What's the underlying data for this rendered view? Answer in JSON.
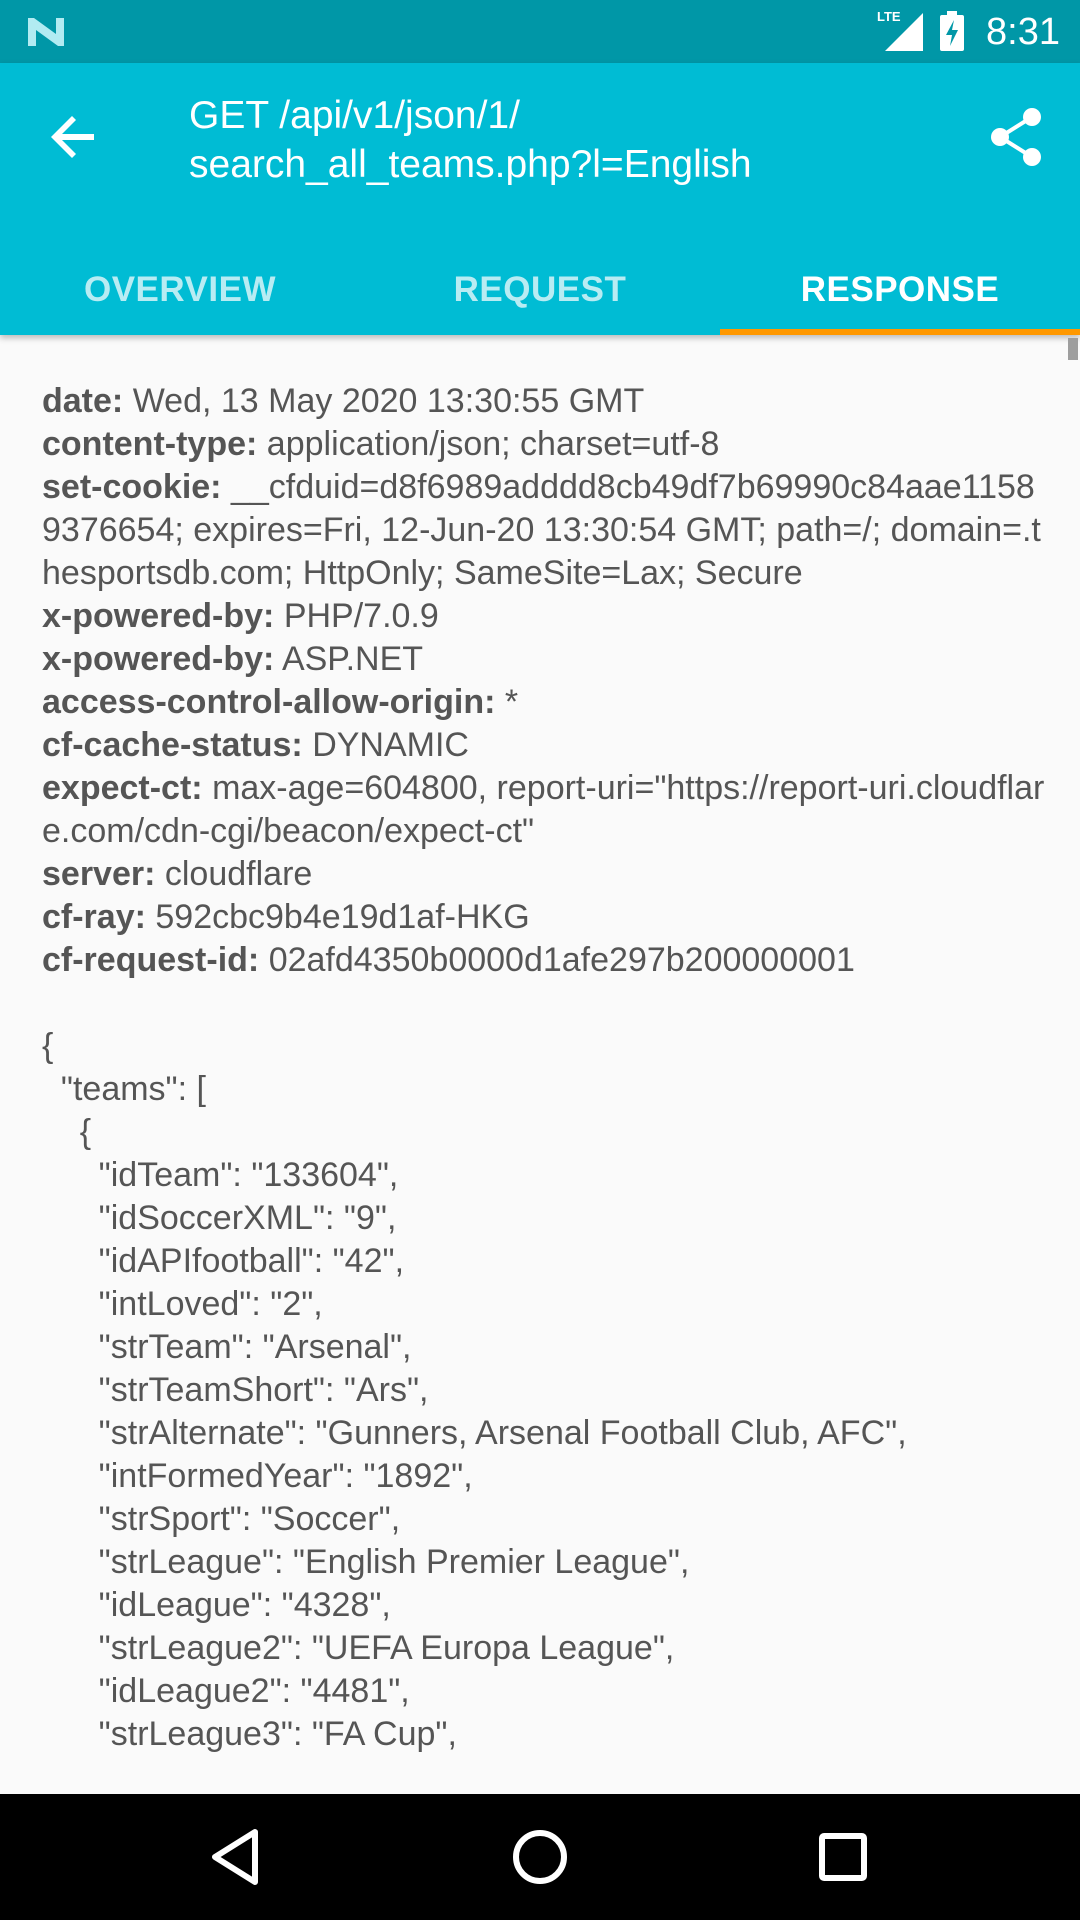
{
  "status_bar": {
    "time": "8:31",
    "network_label": "LTE",
    "icons": [
      "n-logo-icon",
      "lte-signal-icon",
      "battery-charging-icon"
    ]
  },
  "app_bar": {
    "title": "GET /api/v1/json/1/\nsearch_all_teams.php?l=English",
    "back_icon": "arrow-back-icon",
    "share_icon": "share-icon"
  },
  "tabs": [
    {
      "label": "OVERVIEW",
      "active": false
    },
    {
      "label": "REQUEST",
      "active": false
    },
    {
      "label": "RESPONSE",
      "active": true
    }
  ],
  "colors": {
    "status_bar": "#0097a7",
    "app_bar": "#00bcd4",
    "tab_indicator": "#ff9800",
    "background": "#fafafa",
    "text": "#555555"
  },
  "response": {
    "headers": [
      {
        "key": "date:",
        "value": "Wed, 13 May 2020 13:30:55 GMT"
      },
      {
        "key": "content-type:",
        "value": "application/json; charset=utf-8"
      },
      {
        "key": "set-cookie:",
        "value": "__cfduid=d8f6989adddd8cb49df7b69990c84aae11589376654; expires=Fri, 12-Jun-20 13:30:54 GMT; path=/; domain=.thesportsdb.com; HttpOnly; SameSite=Lax; Secure"
      },
      {
        "key": "x-powered-by:",
        "value": "PHP/7.0.9"
      },
      {
        "key": "x-powered-by:",
        "value": "ASP.NET"
      },
      {
        "key": "access-control-allow-origin:",
        "value": "*"
      },
      {
        "key": "cf-cache-status:",
        "value": "DYNAMIC"
      },
      {
        "key": "expect-ct:",
        "value": "max-age=604800, report-uri=\"https://report-uri.cloudflare.com/cdn-cgi/beacon/expect-ct\""
      },
      {
        "key": "server:",
        "value": "cloudflare"
      },
      {
        "key": "cf-ray:",
        "value": "592cbc9b4e19d1af-HKG"
      },
      {
        "key": "cf-request-id:",
        "value": "02afd4350b0000d1afe297b200000001"
      }
    ],
    "body_lines": [
      "{",
      "  \"teams\": [",
      "    {",
      "      \"idTeam\": \"133604\",",
      "      \"idSoccerXML\": \"9\",",
      "      \"idAPIfootball\": \"42\",",
      "      \"intLoved\": \"2\",",
      "      \"strTeam\": \"Arsenal\",",
      "      \"strTeamShort\": \"Ars\",",
      "      \"strAlternate\": \"Gunners, Arsenal Football Club, AFC\",",
      "      \"intFormedYear\": \"1892\",",
      "      \"strSport\": \"Soccer\",",
      "      \"strLeague\": \"English Premier League\",",
      "      \"idLeague\": \"4328\",",
      "      \"strLeague2\": \"UEFA Europa League\",",
      "      \"idLeague2\": \"4481\",",
      "      \"strLeague3\": \"FA Cup\","
    ]
  },
  "nav_bar": {
    "icons": [
      "back-triangle-icon",
      "home-circle-icon",
      "recents-square-icon"
    ]
  }
}
